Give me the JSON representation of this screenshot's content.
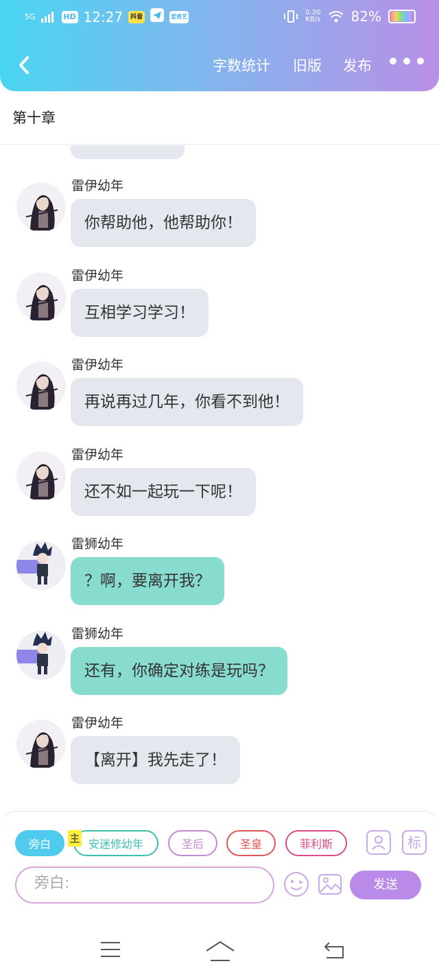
{
  "status_bar": {
    "network": "5G",
    "hd": "HD",
    "time": "12:27",
    "speed_value": "0.20",
    "speed_unit": "KB/s",
    "battery_text": "82%",
    "battery_level": 0.82,
    "app_icon_1": "抖音",
    "app_icon_3": "爱奇艺"
  },
  "header": {
    "word_count_label": "字数统计",
    "old_version_label": "旧版",
    "publish_label": "发布"
  },
  "chapter_title": "第十章",
  "messages": [
    {
      "name": "雷伊幼年",
      "text": "你帮助他，他帮助你！",
      "style": "grey",
      "avatar": "girl"
    },
    {
      "name": "雷伊幼年",
      "text": "互相学习学习！",
      "style": "grey",
      "avatar": "girl"
    },
    {
      "name": "雷伊幼年",
      "text": "再说再过几年，你看不到他！",
      "style": "grey",
      "avatar": "girl"
    },
    {
      "name": "雷伊幼年",
      "text": "还不如一起玩一下呢！",
      "style": "grey",
      "avatar": "girl"
    },
    {
      "name": "雷狮幼年",
      "text": "？啊，要离开我？",
      "style": "teal",
      "avatar": "boy"
    },
    {
      "name": "雷狮幼年",
      "text": "还有，你确定对练是玩吗？",
      "style": "teal",
      "avatar": "boy"
    },
    {
      "name": "雷伊幼年",
      "text": "【离开】我先走了！",
      "style": "grey",
      "avatar": "girl"
    }
  ],
  "characters": [
    {
      "label": "旁白",
      "color": "#4fcbed",
      "active": true
    },
    {
      "label": "安迷修幼年",
      "color": "#3dbfae",
      "active": false
    },
    {
      "label": "圣后",
      "color": "#c48ad4",
      "active": false
    },
    {
      "label": "圣皇",
      "color": "#e05555",
      "active": false
    },
    {
      "label": "菲利斯",
      "color": "#d84b8a",
      "active": false
    }
  ],
  "main_tag": "主",
  "mark_icon_label": "标",
  "input_placeholder": "旁白:",
  "send_label": "发送",
  "icons": {
    "back": "chevron-left-icon",
    "more": "more-dots-icon",
    "role": "role-card-icon",
    "mark": "mark-icon",
    "emoji": "emoji-icon",
    "image": "image-icon",
    "menu": "menu-icon",
    "home": "home-icon",
    "return": "return-icon"
  }
}
